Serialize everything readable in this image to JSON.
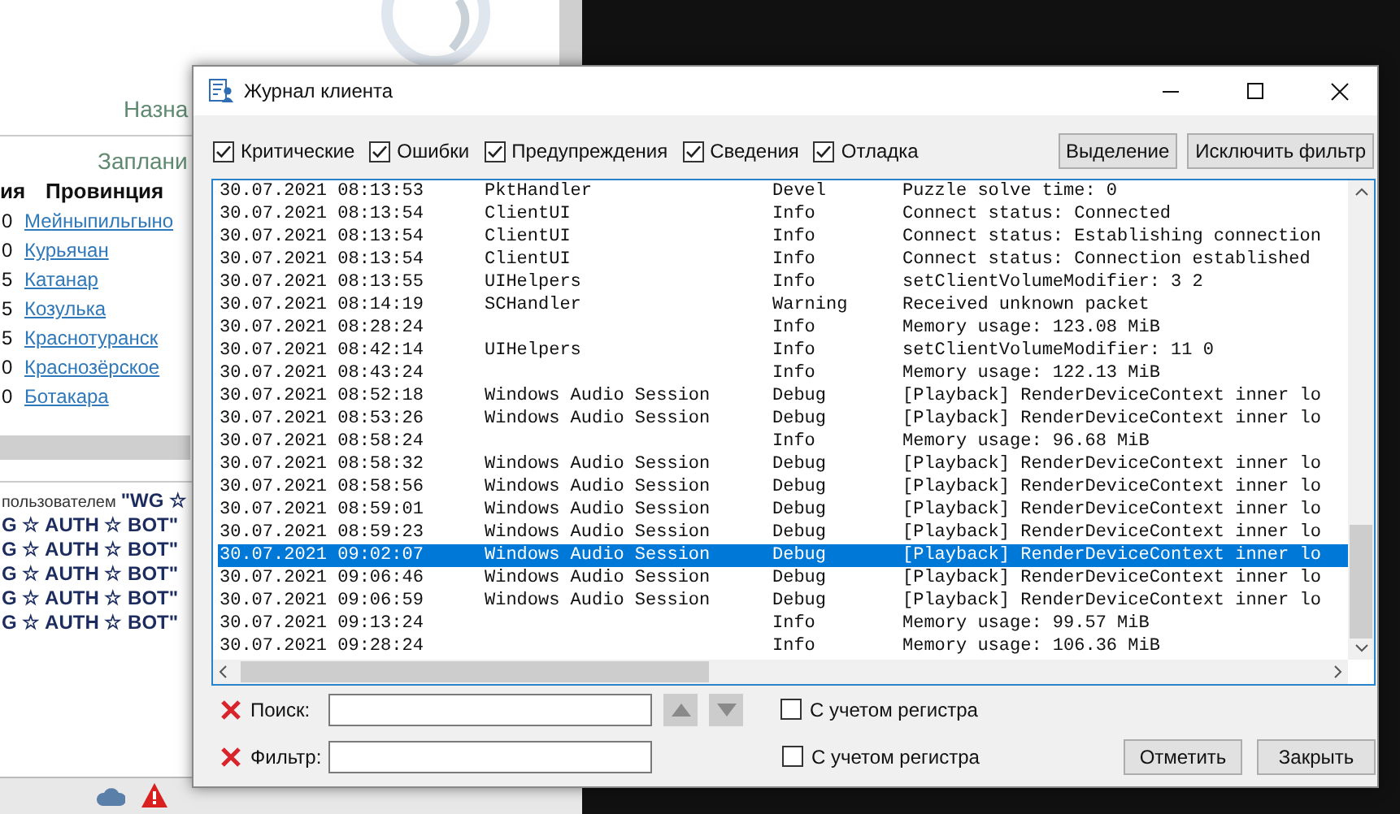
{
  "background_window": {
    "headings": [
      "Назна",
      "Заплани"
    ],
    "table": {
      "columns": [
        "ия",
        "Провинция"
      ],
      "rows": [
        {
          "value": "0",
          "province": "Мейныпильгыно"
        },
        {
          "value": "0",
          "province": "Курьячан"
        },
        {
          "value": "5",
          "province": "Катанар"
        },
        {
          "value": "5",
          "province": "Козулька"
        },
        {
          "value": "5",
          "province": "Краснотуранск"
        },
        {
          "value": "0",
          "province": "Краснозёрское"
        },
        {
          "value": "0",
          "province": "Ботакара"
        }
      ]
    },
    "chat_lines": [
      {
        "prefix": "пользователем",
        "text": "\"WG ☆"
      },
      {
        "text": "G ☆ AUTH ☆ BOT\""
      },
      {
        "text": "G ☆ AUTH ☆ BOT\""
      },
      {
        "text": "G ☆ AUTH ☆ BOT\""
      },
      {
        "text": "G ☆ AUTH ☆ BOT\""
      },
      {
        "text": "G ☆ AUTH ☆ BOT\""
      }
    ]
  },
  "dialog": {
    "title": "Журнал клиента",
    "filters": [
      {
        "label": "Критические",
        "checked": true
      },
      {
        "label": "Ошибки",
        "checked": true
      },
      {
        "label": "Предупреждения",
        "checked": true
      },
      {
        "label": "Сведения",
        "checked": true
      },
      {
        "label": "Отладка",
        "checked": true
      }
    ],
    "buttons": [
      "Выделение",
      "Исключить фильтр"
    ],
    "rows": [
      {
        "date": "30.07.2021 08:13:53",
        "source": "PktHandler",
        "level": "Devel",
        "message": "Puzzle solve time: 0",
        "selected": false
      },
      {
        "date": "30.07.2021 08:13:54",
        "source": "ClientUI",
        "level": "Info",
        "message": "Connect status: Connected",
        "selected": false
      },
      {
        "date": "30.07.2021 08:13:54",
        "source": "ClientUI",
        "level": "Info",
        "message": "Connect status: Establishing connection",
        "selected": false
      },
      {
        "date": "30.07.2021 08:13:54",
        "source": "ClientUI",
        "level": "Info",
        "message": "Connect status: Connection established",
        "selected": false
      },
      {
        "date": "30.07.2021 08:13:55",
        "source": "UIHelpers",
        "level": "Info",
        "message": "setClientVolumeModifier: 3 2",
        "selected": false
      },
      {
        "date": "30.07.2021 08:14:19",
        "source": "SCHandler",
        "level": "Warning",
        "message": "Received unknown packet",
        "selected": false
      },
      {
        "date": "30.07.2021 08:28:24",
        "source": "",
        "level": "Info",
        "message": "Memory usage: 123.08 MiB",
        "selected": false
      },
      {
        "date": "30.07.2021 08:42:14",
        "source": "UIHelpers",
        "level": "Info",
        "message": "setClientVolumeModifier: 11 0",
        "selected": false
      },
      {
        "date": "30.07.2021 08:43:24",
        "source": "",
        "level": "Info",
        "message": "Memory usage: 122.13 MiB",
        "selected": false
      },
      {
        "date": "30.07.2021 08:52:18",
        "source": "Windows Audio Session",
        "level": "Debug",
        "message": "[Playback] RenderDeviceContext inner lo",
        "selected": false
      },
      {
        "date": "30.07.2021 08:53:26",
        "source": "Windows Audio Session",
        "level": "Debug",
        "message": "[Playback] RenderDeviceContext inner lo",
        "selected": false
      },
      {
        "date": "30.07.2021 08:58:24",
        "source": "",
        "level": "Info",
        "message": "Memory usage: 96.68 MiB",
        "selected": false
      },
      {
        "date": "30.07.2021 08:58:32",
        "source": "Windows Audio Session",
        "level": "Debug",
        "message": "[Playback] RenderDeviceContext inner lo",
        "selected": false
      },
      {
        "date": "30.07.2021 08:58:56",
        "source": "Windows Audio Session",
        "level": "Debug",
        "message": "[Playback] RenderDeviceContext inner lo",
        "selected": false
      },
      {
        "date": "30.07.2021 08:59:01",
        "source": "Windows Audio Session",
        "level": "Debug",
        "message": "[Playback] RenderDeviceContext inner lo",
        "selected": false
      },
      {
        "date": "30.07.2021 08:59:23",
        "source": "Windows Audio Session",
        "level": "Debug",
        "message": "[Playback] RenderDeviceContext inner lo",
        "selected": false
      },
      {
        "date": "30.07.2021 09:02:07",
        "source": "Windows Audio Session",
        "level": "Debug",
        "message": "[Playback] RenderDeviceContext inner lo",
        "selected": true
      },
      {
        "date": "30.07.2021 09:06:46",
        "source": "Windows Audio Session",
        "level": "Debug",
        "message": "[Playback] RenderDeviceContext inner lo",
        "selected": false
      },
      {
        "date": "30.07.2021 09:06:59",
        "source": "Windows Audio Session",
        "level": "Debug",
        "message": "[Playback] RenderDeviceContext inner lo",
        "selected": false
      },
      {
        "date": "30.07.2021 09:13:24",
        "source": "",
        "level": "Info",
        "message": "Memory usage: 99.57 MiB",
        "selected": false
      },
      {
        "date": "30.07.2021 09:28:24",
        "source": "",
        "level": "Info",
        "message": "Memory usage: 106.36 MiB",
        "selected": false
      }
    ],
    "search": {
      "label": "Поиск:",
      "navigation_enabled": false,
      "case_label": "С учетом регистра",
      "case_checked": false
    },
    "filter": {
      "label": "Фильтр:",
      "case_label": "С учетом регистра",
      "case_checked": false
    },
    "footer_buttons": [
      "Отметить",
      "Закрыть"
    ]
  }
}
